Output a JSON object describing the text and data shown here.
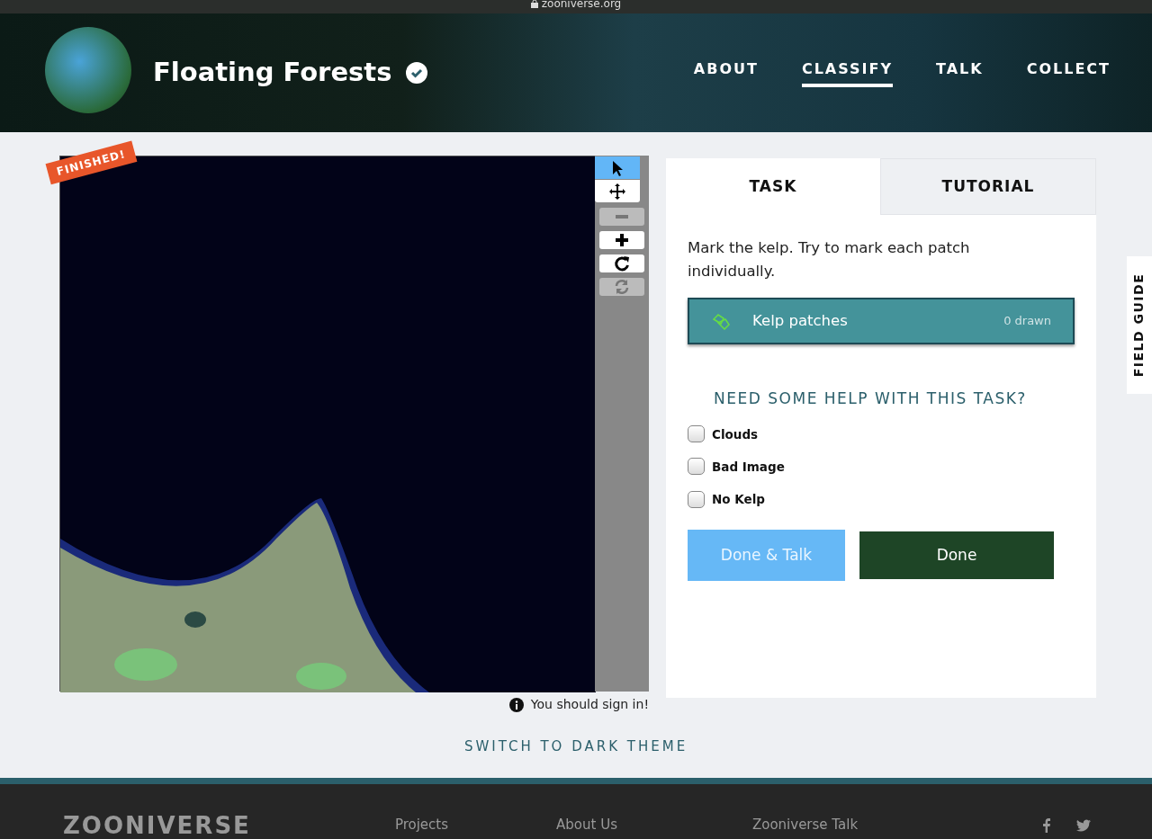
{
  "browser": {
    "url": "zooniverse.org"
  },
  "project": {
    "title": "Floating Forests",
    "verified": true
  },
  "nav": [
    {
      "label": "ABOUT",
      "selected": false
    },
    {
      "label": "CLASSIFY",
      "selected": true
    },
    {
      "label": "TALK",
      "selected": false
    },
    {
      "label": "COLLECT",
      "selected": false
    }
  ],
  "subject": {
    "status_ribbon": "FINISHED!",
    "notice": "You should sign in!"
  },
  "tools": [
    {
      "kind": "pointer",
      "selected": true,
      "disabled": false
    },
    {
      "kind": "move",
      "selected": false,
      "disabled": false
    },
    {
      "kind": "zoom-out",
      "selected": false,
      "disabled": true
    },
    {
      "kind": "zoom-in",
      "selected": false,
      "disabled": false
    },
    {
      "kind": "rotate",
      "selected": false,
      "disabled": false
    },
    {
      "kind": "reset",
      "selected": false,
      "disabled": true
    }
  ],
  "tabs": [
    {
      "label": "TASK",
      "selected": true
    },
    {
      "label": "TUTORIAL",
      "selected": false
    }
  ],
  "task": {
    "instruction": "Mark the kelp. Try to mark each patch individually.",
    "tool": {
      "label": "Kelp patches",
      "count": "0 drawn",
      "color": "#66dd44"
    },
    "help_heading": "NEED SOME HELP WITH THIS TASK?"
  },
  "options": [
    {
      "label": "Clouds",
      "checked": false
    },
    {
      "label": "Bad Image",
      "checked": false
    },
    {
      "label": "No Kelp",
      "checked": false
    }
  ],
  "buttons": [
    {
      "label": "Done & Talk",
      "kind": "secondary"
    },
    {
      "label": "Done",
      "kind": "primary"
    }
  ],
  "field_guide": "FIELD GUIDE",
  "theme_switch": "SWITCH TO DARK THEME",
  "footer": {
    "logo": "ZOONIVERSE",
    "links": [
      "Projects",
      "About Us",
      "Zooniverse Talk"
    ]
  }
}
